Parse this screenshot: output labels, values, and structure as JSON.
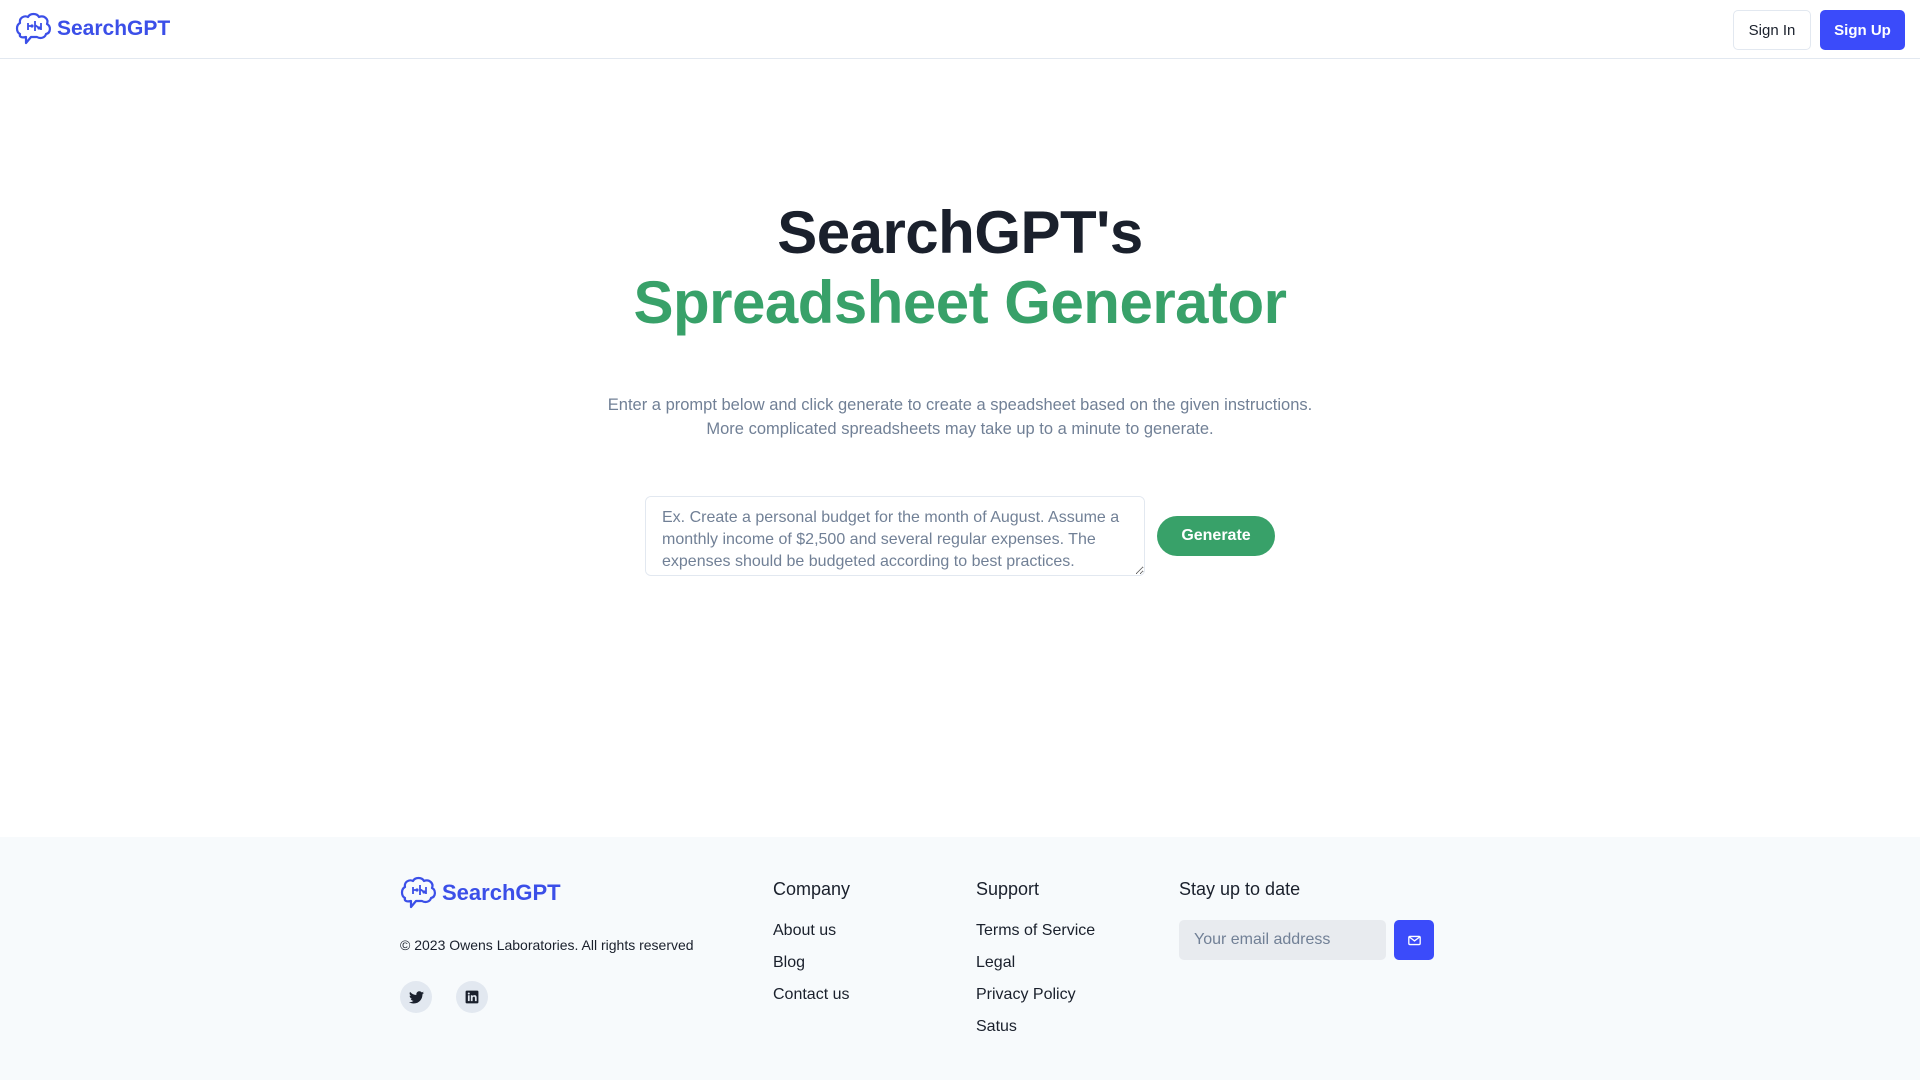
{
  "header": {
    "brand": "SearchGPT",
    "signin_label": "Sign In",
    "signup_label": "Sign Up"
  },
  "hero": {
    "title_line1": "SearchGPT's",
    "title_line2": "Spreadsheet Generator",
    "subtitle_line1": "Enter a prompt below and click generate to create a speadsheet based on the given instructions.",
    "subtitle_line2": "More complicated spreadsheets may take up to a minute to generate.",
    "prompt_placeholder": "Ex. Create a personal budget for the month of August. Assume a monthly income of $2,500 and several regular expenses. The expenses should be budgeted according to best practices.",
    "generate_label": "Generate"
  },
  "footer": {
    "brand": "SearchGPT",
    "copyright": "© 2023 Owens Laboratories. All rights reserved",
    "company": {
      "heading": "Company",
      "links": [
        "About us",
        "Blog",
        "Contact us"
      ]
    },
    "support": {
      "heading": "Support",
      "links": [
        "Terms of Service",
        "Legal",
        "Privacy Policy",
        "Satus"
      ]
    },
    "newsletter": {
      "heading": "Stay up to date",
      "email_placeholder": "Your email address"
    },
    "social_icons": [
      "twitter-icon",
      "linkedin-icon"
    ]
  },
  "colors": {
    "brand_blue": "#3b4bfa",
    "accent_green": "#38a169",
    "footer_bg": "#f7fafc"
  }
}
